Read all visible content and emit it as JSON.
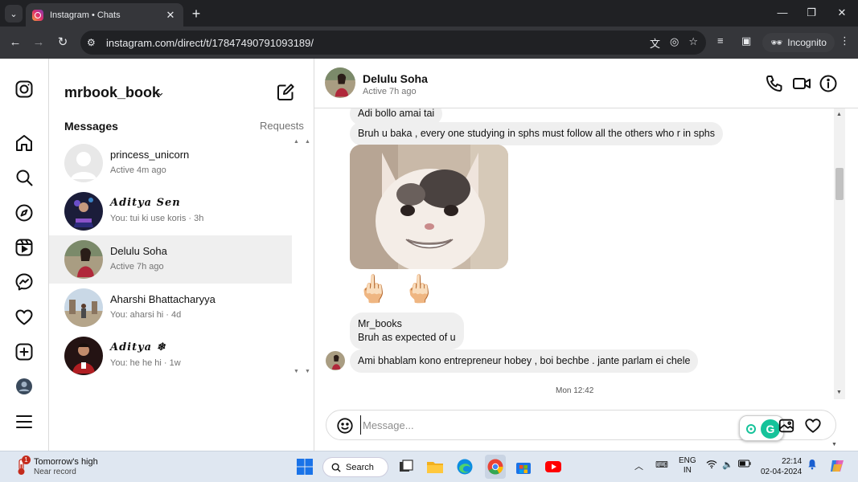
{
  "browser": {
    "tab_title": "Instagram • Chats",
    "url": "instagram.com/direct/t/17847490791093189/",
    "incognito_label": "Incognito"
  },
  "sidebar": {
    "username": "mrbook_book",
    "messages_label": "Messages",
    "requests_label": "Requests",
    "conversations": [
      {
        "name": "princess_unicorn",
        "subtitle": "Active 4m ago"
      },
      {
        "name": "𝑨𝒅𝒊𝒕𝒚𝒂 𝑺𝒆𝒏",
        "subtitle": "You: tui ki use koris · 3h"
      },
      {
        "name": "Delulu Soha",
        "subtitle": "Active 7h ago"
      },
      {
        "name": "Aharshi Bhattacharyya",
        "subtitle": "You: aharsi hi · 4d"
      },
      {
        "name": "𝑨𝒅𝒊𝒕𝒚𝒂 ❄",
        "subtitle": "You: he he hi · 1w"
      }
    ]
  },
  "chat": {
    "contact_name": "Delulu Soha",
    "contact_status": "Active 7h ago",
    "messages": [
      {
        "text": "Adi bollo amai tai"
      },
      {
        "text": "Bruh u baka , every one studying in sphs must follow all the others who r in sphs"
      },
      {
        "line1": "Mr_books",
        "line2": "Bruh as expected of u"
      },
      {
        "text": "Ami bhablam kono entrepreneur hobey , boi bechbe . jante parlam ei chele"
      }
    ],
    "emoji_reaction": "🖕🏻",
    "day_stamp": "Mon 12:42",
    "composer_placeholder": "Message..."
  },
  "taskbar": {
    "weather_title": "Tomorrow's high",
    "weather_sub": "Near record",
    "weather_badge": "1",
    "search_label": "Search",
    "lang_line1": "ENG",
    "lang_line2": "IN",
    "time": "22:14",
    "date": "02-04-2024"
  }
}
